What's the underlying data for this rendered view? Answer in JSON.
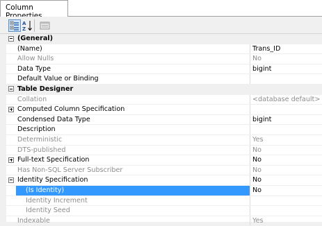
{
  "tab": {
    "label": "Column Properties"
  },
  "toolbar": {
    "buttons": [
      {
        "name": "categorized-view-button",
        "icon": "categorized-icon",
        "selected": true
      },
      {
        "name": "alphabetical-sort-button",
        "icon": "sort-az-icon",
        "selected": false
      },
      {
        "name": "property-pages-button",
        "icon": "property-pages-icon",
        "selected": false
      }
    ]
  },
  "rows": [
    {
      "type": "category",
      "name": "(General)",
      "expanded": true
    },
    {
      "name": "(Name)",
      "value": "Trans_ID"
    },
    {
      "name": "Allow Nulls",
      "value": "No",
      "gray": true
    },
    {
      "name": "Data Type",
      "value": "bigint"
    },
    {
      "name": "Default Value or Binding",
      "value": ""
    },
    {
      "type": "category",
      "name": "Table Designer",
      "expanded": true
    },
    {
      "name": "Collation",
      "value": "<database default>",
      "gray": true
    },
    {
      "name": "Computed Column Specification",
      "value": "",
      "expander": "plus"
    },
    {
      "name": "Condensed Data Type",
      "value": "bigint"
    },
    {
      "name": "Description",
      "value": ""
    },
    {
      "name": "Deterministic",
      "value": "Yes",
      "gray": true
    },
    {
      "name": "DTS-published",
      "value": "No",
      "gray": true
    },
    {
      "name": "Full-text Specification",
      "value": "No",
      "expander": "plus"
    },
    {
      "name": "Has Non-SQL Server Subscriber",
      "value": "No",
      "gray": true
    },
    {
      "name": "Identity Specification",
      "value": "No",
      "expander": "minus"
    },
    {
      "name": "(Is Identity)",
      "value": "No",
      "indent": true,
      "selected": true
    },
    {
      "name": "Identity Increment",
      "value": "",
      "indent": true,
      "gray": true
    },
    {
      "name": "Identity Seed",
      "value": "",
      "indent": true,
      "gray": true
    },
    {
      "name": "Indexable",
      "value": "Yes",
      "gray": true
    }
  ]
}
